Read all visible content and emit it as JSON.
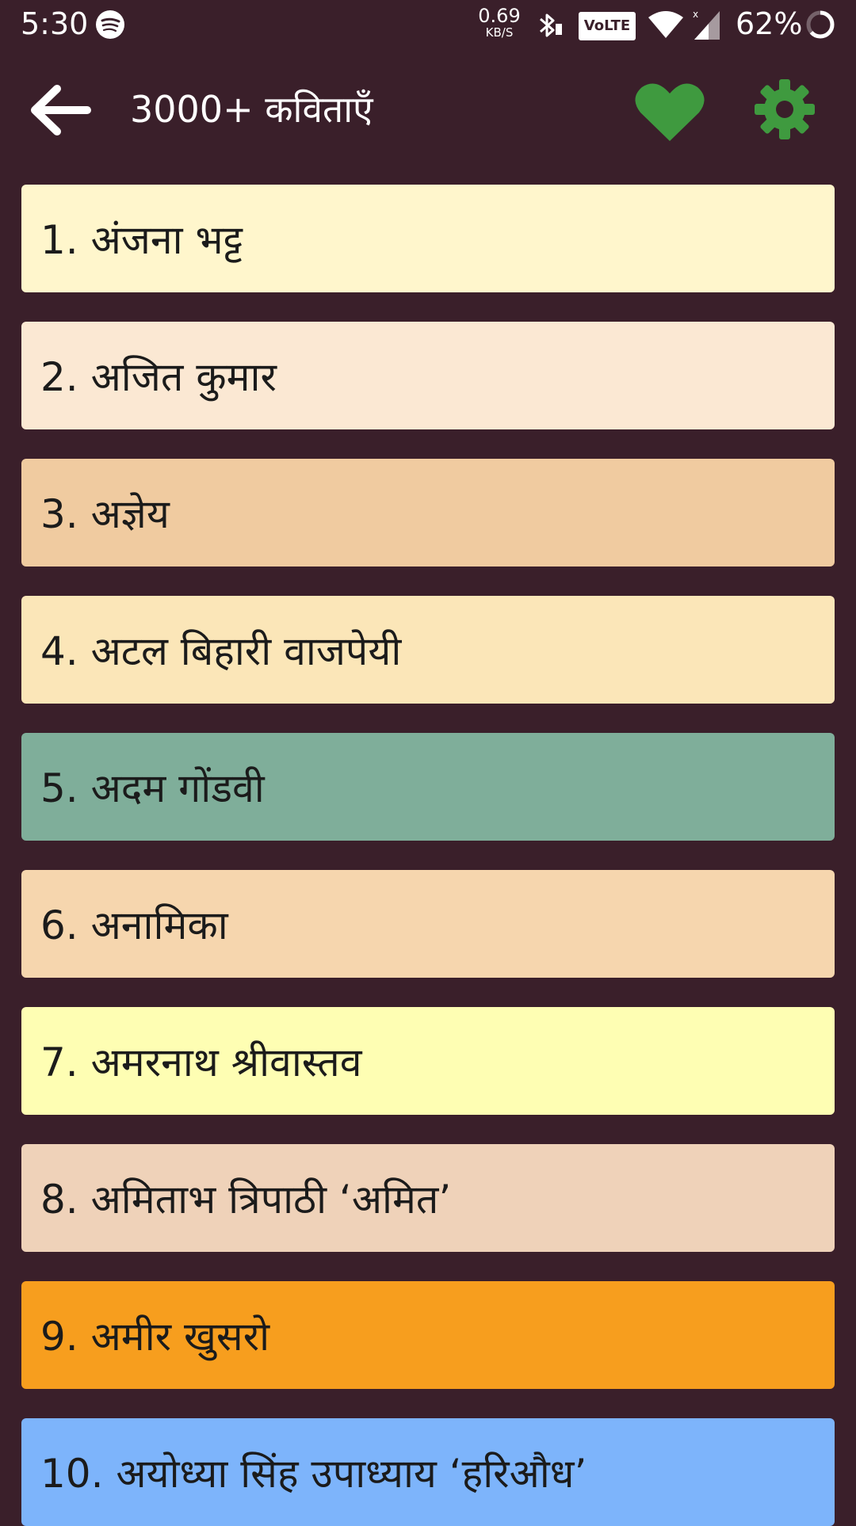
{
  "status": {
    "time": "5:30",
    "net_speed": "0.69",
    "net_unit": "KB/S",
    "volte": "VoLTE",
    "battery": "62%"
  },
  "appbar": {
    "title": "3000+ कविताएँ"
  },
  "colors": {
    "background": "#3a1f2a",
    "accent_green": "#3f9a3f"
  },
  "poets": [
    {
      "label": "1. अंजना भट्ट",
      "color": "#fff6cc"
    },
    {
      "label": "2. अजित कुमार",
      "color": "#fbe8d3"
    },
    {
      "label": "3. अज्ञेय",
      "color": "#f0cba0"
    },
    {
      "label": "4. अटल बिहारी वाजपेयी",
      "color": "#fbe6b8"
    },
    {
      "label": "5. अदम गोंडवी",
      "color": "#7fae9a"
    },
    {
      "label": "6. अनामिका",
      "color": "#f6d6ae"
    },
    {
      "label": "7. अमरनाथ श्रीवास्तव",
      "color": "#fefeb3"
    },
    {
      "label": "8. अमिताभ त्रिपाठी ‘अमित’",
      "color": "#efd2b9"
    },
    {
      "label": "9. अमीर खुसरो",
      "color": "#f79e1e"
    },
    {
      "label": "10. अयोध्या सिंह उपाध्याय ‘हरिऔध’",
      "color": "#7db4fb"
    }
  ]
}
